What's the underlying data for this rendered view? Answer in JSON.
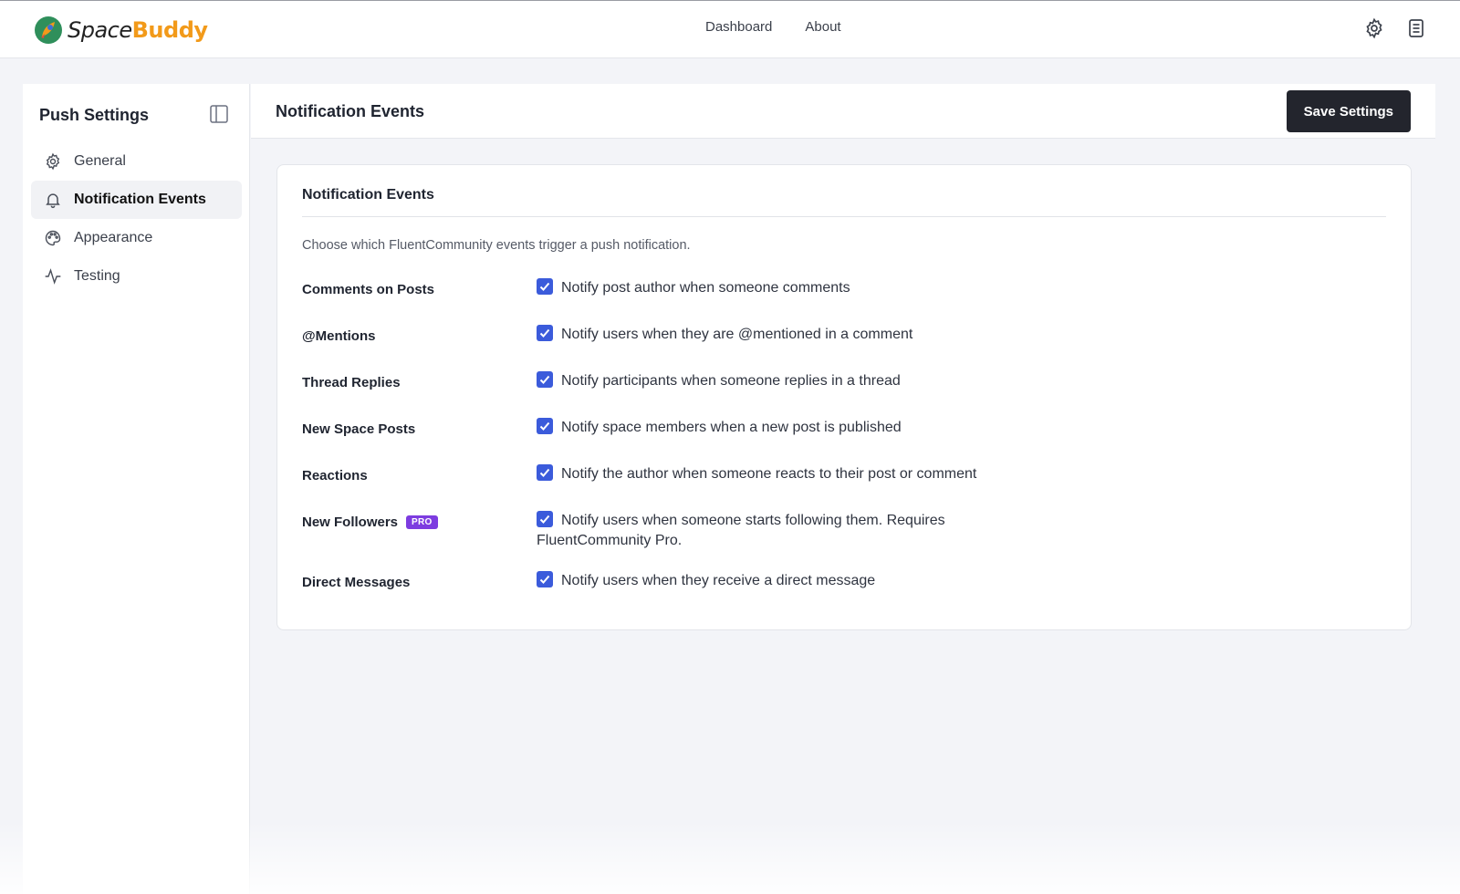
{
  "brand": {
    "name_part1": "Space",
    "name_part2": "Buddy",
    "accent": "#f29a1a"
  },
  "topnav": {
    "items": [
      "Dashboard",
      "About"
    ]
  },
  "top_icons": [
    "gear-icon",
    "document-icon"
  ],
  "sidebar": {
    "title": "Push Settings",
    "items": [
      {
        "label": "General",
        "icon": "gear-icon",
        "active": false
      },
      {
        "label": "Notification Events",
        "icon": "bell-icon",
        "active": true
      },
      {
        "label": "Appearance",
        "icon": "palette-icon",
        "active": false
      },
      {
        "label": "Testing",
        "icon": "activity-icon",
        "active": false
      }
    ]
  },
  "main": {
    "title": "Notification Events",
    "save_label": "Save Settings"
  },
  "card": {
    "title": "Notification Events",
    "description": "Choose which FluentCommunity events trigger a push notification.",
    "rows": [
      {
        "label": "Comments on Posts",
        "text": "Notify post author when someone comments",
        "checked": true
      },
      {
        "label": "@Mentions",
        "text": "Notify users when they are @mentioned in a comment",
        "checked": true
      },
      {
        "label": "Thread Replies",
        "text": "Notify participants when someone replies in a thread",
        "checked": true
      },
      {
        "label": "New Space Posts",
        "text": "Notify space members when a new post is published",
        "checked": true
      },
      {
        "label": "Reactions",
        "text": "Notify the author when someone reacts to their post or comment",
        "checked": true
      },
      {
        "label": "New Followers",
        "badge": "PRO",
        "text": "Notify users when someone starts following them. Requires FluentCommunity Pro.",
        "checked": true
      },
      {
        "label": "Direct Messages",
        "text": "Notify users when they receive a direct message",
        "checked": true
      }
    ]
  },
  "colors": {
    "checkbox": "#3b5bdb",
    "pro_badge": "#7d3ce0",
    "save_button": "#23252d"
  }
}
